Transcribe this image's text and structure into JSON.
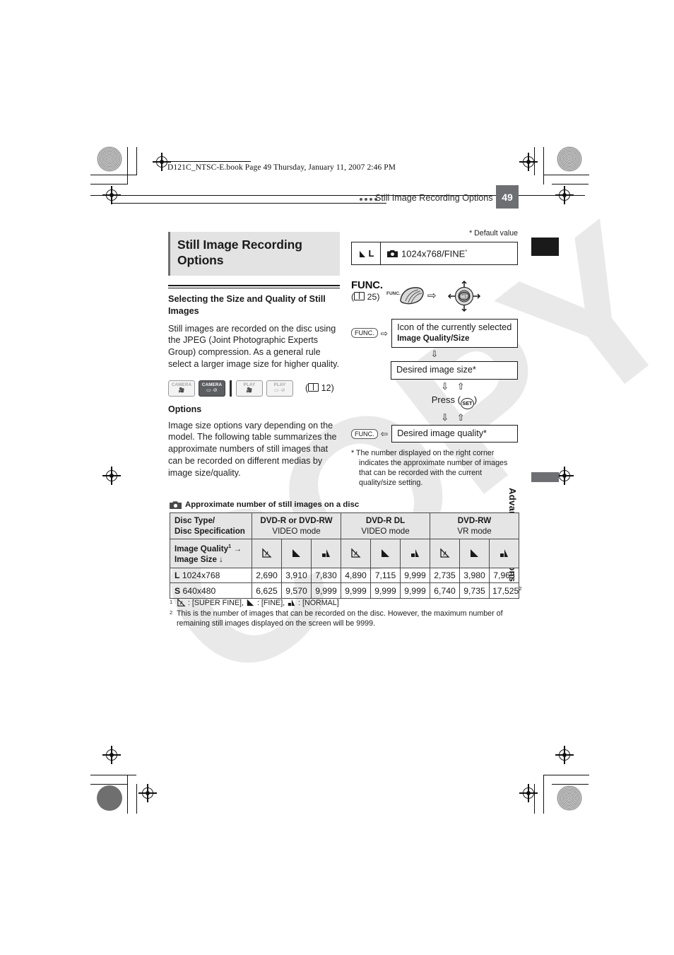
{
  "header": {
    "book_line": "D121C_NTSC-E.book  Page 49  Thursday, January 11, 2007  2:46 PM",
    "running_title": "Still Image Recording Options",
    "page_number": "49"
  },
  "sidebar": {
    "section_label": "Advanced Functions"
  },
  "watermark": {
    "text": "COPY"
  },
  "left_column": {
    "title": "Still Image Recording Options",
    "subsection_title": "Selecting the Size and Quality of Still Images",
    "intro_paragraph": "Still images are recorded on the disc using the JPEG (Joint Photographic Experts Group) compression. As a general rule select a larger image size for higher quality.",
    "modes": [
      {
        "name": "camera-video-mode",
        "label": "CAMERA",
        "glyph": "movie",
        "active": false
      },
      {
        "name": "camera-photo-mode",
        "label": "CAMERA",
        "glyph": "photo",
        "active": true
      },
      {
        "name": "play-video-mode",
        "label": "PLAY",
        "glyph": "movie",
        "active": false
      },
      {
        "name": "play-photo-mode",
        "label": "PLAY",
        "glyph": "photo",
        "active": false
      }
    ],
    "mode_page_ref": "12",
    "options_heading": "Options",
    "options_paragraph": "Image size options vary depending on the model. The following table summarizes the approximate numbers of still images that can be recorded on different medias by image size/quality."
  },
  "right_column": {
    "default_value_note": "* Default value",
    "option_row": {
      "quality_size_label": "L",
      "value": "1024x768/FINE",
      "default_marker": "*"
    },
    "func_block": {
      "func_title": "FUNC.",
      "func_page_ref": "25",
      "dial_label": "FUNC.",
      "arrow": "⇨",
      "joystick_set_label": "SET"
    },
    "flow": {
      "step1_tag": "FUNC.",
      "step1_arrow": "⇨",
      "step1_line1": "Icon of the currently selected",
      "step1_line2": "Image Quality/Size",
      "down1": "⇩",
      "step2": "Desired image size*",
      "down2": "⇩ ⇧",
      "press_text": "Press (",
      "press_set": "SET",
      "press_close": ")",
      "down3": "⇩ ⇧",
      "step3_tag": "FUNC.",
      "step3_arrow": "⇦",
      "step3": "Desired image quality*"
    },
    "footnote": "* The number displayed on the right corner indicates the approximate number of images that can be recorded with the current quality/size setting."
  },
  "table": {
    "caption": "Approximate number of still images on a disc",
    "col1_header_line1": "Disc Type/",
    "col1_header_line2": "Disc Specification",
    "disc_groups": [
      {
        "line1": "DVD-R or DVD-RW",
        "line2": "VIDEO mode"
      },
      {
        "line1": "DVD-R DL",
        "line2": "VIDEO mode"
      },
      {
        "line1": "DVD-RW",
        "line2": "VR mode"
      }
    ],
    "quality_header_line1": "Image Quality",
    "quality_header_sup1": "1",
    "quality_header_arrow1": "→",
    "quality_header_line2": "Image Size",
    "quality_header_arrow2": "↓",
    "quality_icons": [
      "super-fine",
      "fine",
      "normal",
      "super-fine",
      "fine",
      "normal",
      "super-fine",
      "fine",
      "normal"
    ],
    "rows": [
      {
        "size_bold": "L",
        "size_text": "1024x768",
        "values": [
          "2,690",
          "3,910",
          "7,830",
          "4,890",
          "7,115",
          "9,999",
          "2,735",
          "3,980",
          "7,965"
        ],
        "sups": [
          "",
          "",
          "",
          "",
          "",
          "",
          "",
          "",
          ""
        ]
      },
      {
        "size_bold": "S",
        "size_text": "640x480",
        "values": [
          "6,625",
          "9,570",
          "9,999",
          "9,999",
          "9,999",
          "9,999",
          "6,740",
          "9,735",
          "17,525"
        ],
        "sups": [
          "",
          "",
          "",
          "",
          "",
          "",
          "",
          "",
          "2"
        ]
      }
    ]
  },
  "footnotes": [
    {
      "marker": "1",
      "text": ": [SUPER FINE],  : [FINE],  : [NORMAL]"
    },
    {
      "marker": "2",
      "text": "This is the number of images that can be recorded on the disc. However, the maximum number of remaining still images displayed on the screen will be 9999."
    }
  ],
  "footnote1_parts": {
    "sf": ": [SUPER FINE],",
    "f": ": [FINE],",
    "n": ": [NORMAL]"
  },
  "colors": {
    "badge_gray": "#6e6f73",
    "band_gray": "#e3e3e3",
    "table_header_gray": "#e5e5e5"
  }
}
